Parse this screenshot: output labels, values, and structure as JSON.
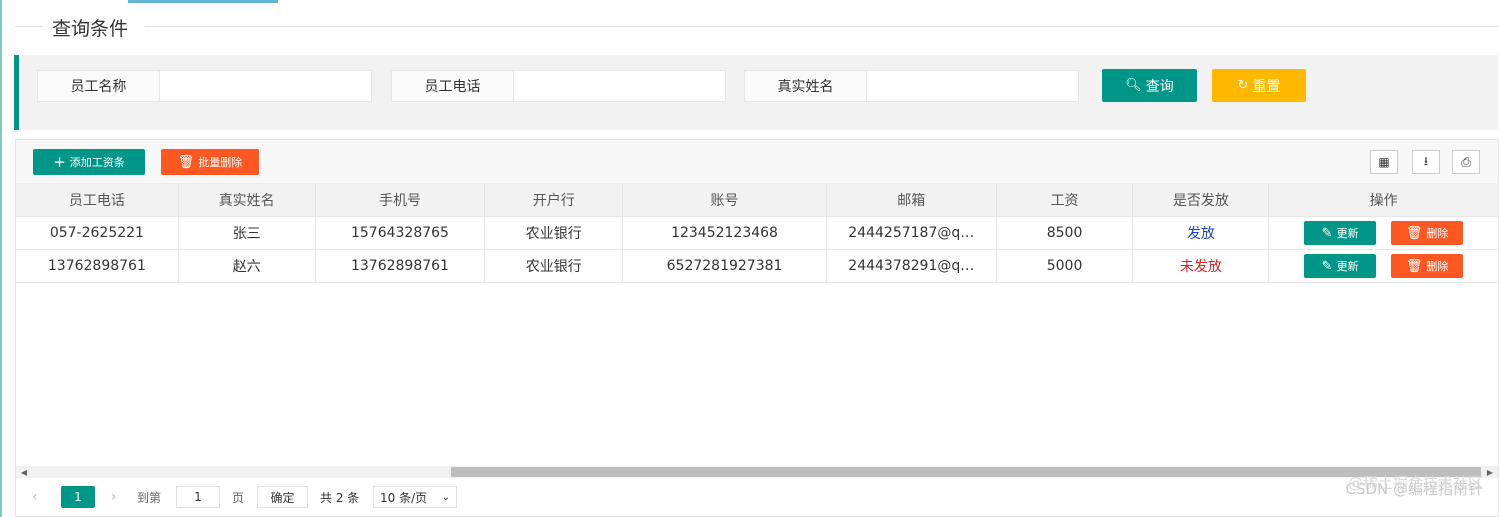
{
  "fieldset_title": "查询条件",
  "search": {
    "fields": [
      {
        "label": "员工名称",
        "value": ""
      },
      {
        "label": "员工电话",
        "value": ""
      },
      {
        "label": "真实姓名",
        "value": ""
      }
    ],
    "query_label": "查询",
    "reset_label": "重置"
  },
  "toolbar": {
    "add_label": "添加工资条",
    "batch_delete_label": "批量删除",
    "icons": [
      "columns-icon",
      "export-icon",
      "print-icon"
    ]
  },
  "table": {
    "headers": [
      "员工电话",
      "真实姓名",
      "手机号",
      "开户行",
      "账号",
      "邮箱",
      "工资",
      "是否发放",
      "操作"
    ],
    "rows": [
      {
        "phone": "057-2625221",
        "name": "张三",
        "mobile": "15764328765",
        "bank": "农业银行",
        "account": "123452123468",
        "email": "2444257187@q…",
        "salary": "8500",
        "status": "发放",
        "update": "更新",
        "delete": "删除"
      },
      {
        "phone": "13762898761",
        "name": "赵六",
        "mobile": "13762898761",
        "bank": "农业银行",
        "account": "6527281927381",
        "email": "2444378291@q…",
        "salary": "5000",
        "status": "未发放",
        "update": "更新",
        "delete": "删除"
      }
    ]
  },
  "pager": {
    "current": "1",
    "goto_prefix": "到第",
    "goto_value": "1",
    "goto_suffix": "页",
    "confirm": "确定",
    "total": "共 2 条",
    "page_size": "10 条/页"
  },
  "watermark": "CSDN @编程指南针",
  "watermark_overlay": "@稀土掘金技术社区",
  "colors": {
    "primary": "#009688",
    "warn": "#ffb800",
    "danger": "#ff5722",
    "paid": "#1e3ec8",
    "unpaid": "#e31e1e"
  }
}
